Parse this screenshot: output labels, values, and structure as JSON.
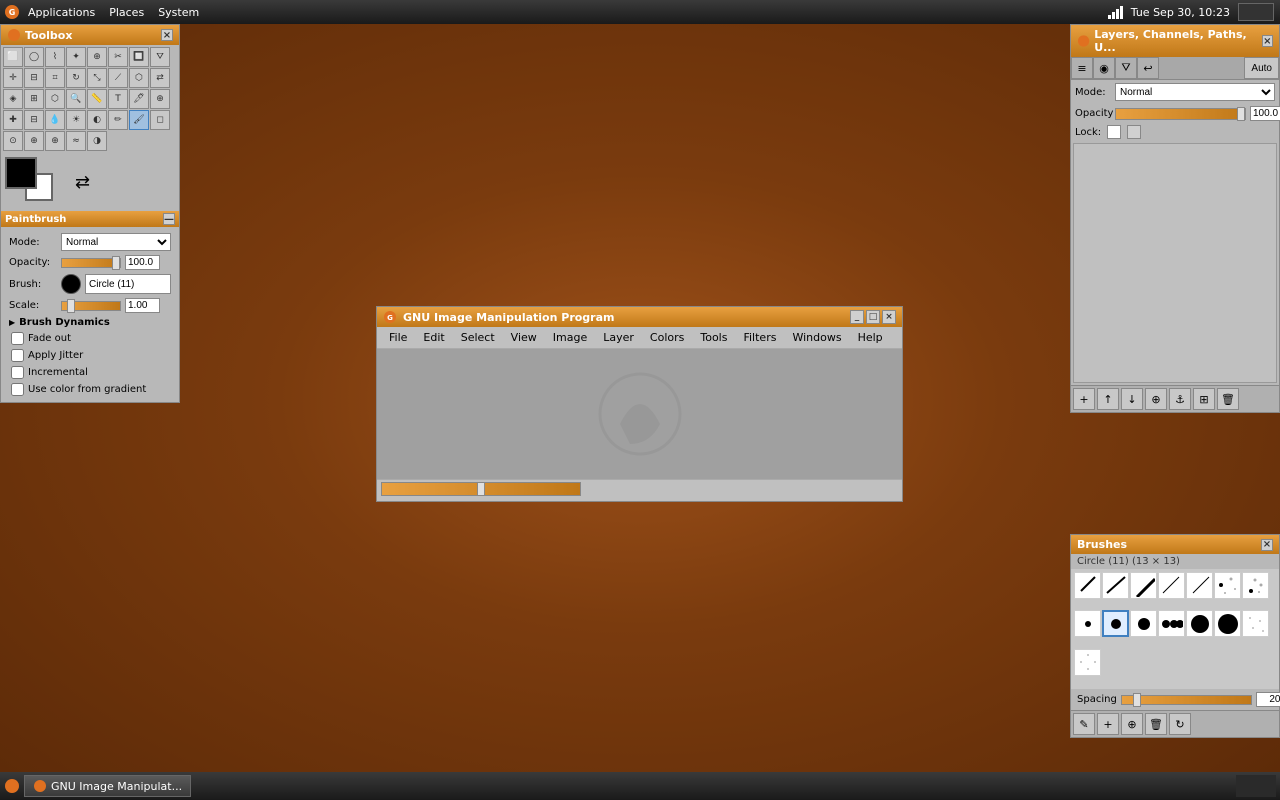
{
  "taskbar": {
    "apps_label": "Applications",
    "places_label": "Places",
    "system_label": "System",
    "time": "Tue Sep 30, 10:23",
    "gimp_task": "GNU Image Manipulat..."
  },
  "toolbox": {
    "title": "Toolbox",
    "paintbrush_section": "Paintbrush",
    "mode_label": "Mode:",
    "mode_value": "Normal",
    "opacity_label": "Opacity:",
    "opacity_value": "100.0",
    "brush_label": "Brush:",
    "brush_name": "Circle (11)",
    "scale_label": "Scale:",
    "scale_value": "1.00",
    "brush_dynamics": "Brush Dynamics",
    "fade_out": "Fade out",
    "apply_jitter": "Apply Jitter",
    "incremental": "Incremental",
    "use_color_gradient": "Use color from gradient"
  },
  "gimp_window": {
    "title": "GNU Image Manipulation Program",
    "menu": {
      "file": "File",
      "edit": "Edit",
      "select": "Select",
      "view": "View",
      "image": "Image",
      "layer": "Layer",
      "colors": "Colors",
      "tools": "Tools",
      "filters": "Filters",
      "windows": "Windows",
      "help": "Help"
    }
  },
  "layers_panel": {
    "title": "Layers, Channels, Paths, U...",
    "tabs": [
      "Layers",
      "Channels",
      "Paths",
      "Undo"
    ],
    "mode_label": "Mode:",
    "mode_value": "Normal",
    "opacity_label": "Opacity",
    "opacity_value": "100.0",
    "lock_label": "Lock:",
    "auto_btn": "Auto"
  },
  "brushes_panel": {
    "title": "Brushes",
    "brush_info": "Circle (11) (13 × 13)",
    "spacing_label": "Spacing",
    "spacing_value": "20.0"
  }
}
